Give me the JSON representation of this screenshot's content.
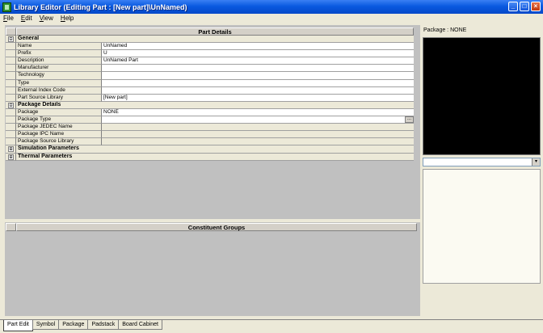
{
  "window": {
    "title": "Library Editor (Editing Part : [New part]\\UnNamed)",
    "controls": [
      "_",
      "□",
      "×"
    ]
  },
  "menu": [
    "File",
    "Edit",
    "View",
    "Help"
  ],
  "part_details": {
    "header": "Part Details",
    "rows": [
      {
        "type": "section",
        "expander": "⊟",
        "label": "General"
      },
      {
        "type": "field",
        "label": "Name",
        "value": "UnNamed"
      },
      {
        "type": "field",
        "label": "Prefix",
        "value": "U"
      },
      {
        "type": "field",
        "label": "Description",
        "value": "UnNamed Part"
      },
      {
        "type": "field",
        "label": "Manufacturer",
        "value": ""
      },
      {
        "type": "field",
        "label": "Technology",
        "value": ""
      },
      {
        "type": "field",
        "label": "Type",
        "value": ""
      },
      {
        "type": "field",
        "label": "External Index Code",
        "value": ""
      },
      {
        "type": "field",
        "label": "Part Source Library",
        "value": "[New part]"
      },
      {
        "type": "section",
        "expander": "⊟",
        "label": "Package Details"
      },
      {
        "type": "field",
        "label": "Package",
        "value": "NONE"
      },
      {
        "type": "field",
        "label": "Package Type",
        "value": "",
        "button": "..."
      },
      {
        "type": "field",
        "label": "Package JEDEC Name",
        "value": "",
        "readonly": true
      },
      {
        "type": "field",
        "label": "Package IPC Name",
        "value": "",
        "readonly": true
      },
      {
        "type": "field",
        "label": "Package Source Library",
        "value": "",
        "readonly": true
      },
      {
        "type": "section",
        "expander": "⊞",
        "label": "Simulation Parameters"
      },
      {
        "type": "section",
        "expander": "⊞",
        "label": "Thermal Parameters"
      }
    ]
  },
  "constituent_groups": {
    "header": "Constituent Groups"
  },
  "package_preview": {
    "label": "Package : NONE",
    "combo_value": "",
    "combo_arrow": "▾"
  },
  "tabs": [
    {
      "label": "Part Edit",
      "active": true
    },
    {
      "label": "Symbol",
      "active": false
    },
    {
      "label": "Package",
      "active": false
    },
    {
      "label": "Padstack",
      "active": false
    },
    {
      "label": "Board Cabinet",
      "active": false
    }
  ]
}
